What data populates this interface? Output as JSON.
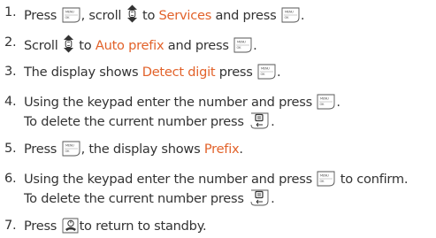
{
  "steps": [
    {
      "num": "1.",
      "parts": [
        {
          "t": "text",
          "v": "Press "
        },
        {
          "t": "icon",
          "icon": "menu-ok-key"
        },
        {
          "t": "text",
          "v": ", scroll "
        },
        {
          "t": "icon",
          "icon": "scroll-key"
        },
        {
          "t": "text",
          "v": " to "
        },
        {
          "t": "hl",
          "v": "Services"
        },
        {
          "t": "text",
          "v": " and press "
        },
        {
          "t": "icon",
          "icon": "menu-ok-key"
        },
        {
          "t": "text",
          "v": "."
        }
      ]
    },
    {
      "num": "2.",
      "parts": [
        {
          "t": "text",
          "v": "Scroll "
        },
        {
          "t": "icon",
          "icon": "scroll-key"
        },
        {
          "t": "text",
          "v": " to "
        },
        {
          "t": "hl",
          "v": "Auto prefix"
        },
        {
          "t": "text",
          "v": " and press "
        },
        {
          "t": "icon",
          "icon": "menu-ok-key"
        },
        {
          "t": "text",
          "v": "."
        }
      ]
    },
    {
      "num": "3.",
      "parts": [
        {
          "t": "text",
          "v": "The display shows "
        },
        {
          "t": "hl",
          "v": "Detect digit"
        },
        {
          "t": "text",
          "v": " press "
        },
        {
          "t": "icon",
          "icon": "menu-ok-key"
        },
        {
          "t": "text",
          "v": "."
        }
      ]
    },
    {
      "num": "4.",
      "parts": [
        {
          "t": "text",
          "v": "Using the keypad enter the number and press "
        },
        {
          "t": "icon",
          "icon": "menu-ok-key"
        },
        {
          "t": "text",
          "v": "."
        },
        {
          "t": "br"
        },
        {
          "t": "text",
          "v": "To delete the current number press "
        },
        {
          "t": "icon",
          "icon": "delete-key"
        },
        {
          "t": "text",
          "v": "."
        }
      ]
    },
    {
      "num": "5.",
      "parts": [
        {
          "t": "text",
          "v": "Press "
        },
        {
          "t": "icon",
          "icon": "menu-ok-key"
        },
        {
          "t": "text",
          "v": ", the display shows "
        },
        {
          "t": "hl",
          "v": "Prefix"
        },
        {
          "t": "text",
          "v": "."
        }
      ]
    },
    {
      "num": "6.",
      "parts": [
        {
          "t": "text",
          "v": "Using the keypad enter the number and press "
        },
        {
          "t": "icon",
          "icon": "menu-ok-key"
        },
        {
          "t": "text",
          "v": " to confirm."
        },
        {
          "t": "br"
        },
        {
          "t": "text",
          "v": "To delete the current number press "
        },
        {
          "t": "icon",
          "icon": "delete-key"
        },
        {
          "t": "text",
          "v": "."
        }
      ]
    },
    {
      "num": "7.",
      "parts": [
        {
          "t": "text",
          "v": "Press "
        },
        {
          "t": "icon",
          "icon": "end-key"
        },
        {
          "t": "text",
          "v": "to return to standby."
        }
      ]
    }
  ],
  "icons": {
    "menu-ok-key": {
      "top": "MENU",
      "bottom": "OK"
    }
  },
  "colors": {
    "text": "#333333",
    "highlight": "#e2622a"
  }
}
